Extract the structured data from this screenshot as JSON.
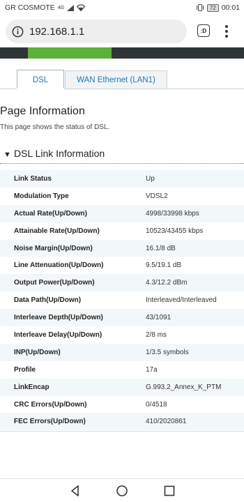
{
  "status_bar": {
    "carrier": "GR COSMOTE",
    "network_type": "4G",
    "battery": "72",
    "time": "00:01",
    "icons": [
      "signal-icon",
      "wifi-icon",
      "vibrate-icon",
      "battery-icon"
    ]
  },
  "browser": {
    "url": "192.168.1.1",
    "tab_count": ":D",
    "icons": [
      "info-icon",
      "tabs-icon",
      "more-vert-icon"
    ]
  },
  "colors": {
    "header_dark": "#2f3437",
    "header_green": "#5cb13a",
    "tab_text": "#1f79b5",
    "row_alt": "#f2f7fa"
  },
  "tabs": [
    {
      "label": "DSL",
      "active": true
    },
    {
      "label": "WAN Ethernet (LAN1)",
      "active": false
    }
  ],
  "page": {
    "title": "Page Information",
    "description": "This page shows the status of DSL."
  },
  "section": {
    "title": "DSL Link Information",
    "icon": "triangle-down-icon"
  },
  "rows": [
    {
      "label": "Link Status",
      "value": "Up"
    },
    {
      "label": "Modulation Type",
      "value": "VDSL2"
    },
    {
      "label": "Actual Rate(Up/Down)",
      "value": "4998/33998 kbps"
    },
    {
      "label": "Attainable Rate(Up/Down)",
      "value": "10523/43455 kbps"
    },
    {
      "label": "Noise Margin(Up/Down)",
      "value": "16.1/8 dB"
    },
    {
      "label": "Line Attenuation(Up/Down)",
      "value": "9.5/19.1 dB"
    },
    {
      "label": "Output Power(Up/Down)",
      "value": "4.3/12.2 dBm"
    },
    {
      "label": "Data Path(Up/Down)",
      "value": "Interleaved/Interleaved"
    },
    {
      "label": "Interleave Depth(Up/Down)",
      "value": "43/1091"
    },
    {
      "label": "Interleave Delay(Up/Down)",
      "value": "2/8 ms"
    },
    {
      "label": "INP(Up/Down)",
      "value": "1/3.5 symbols"
    },
    {
      "label": "Profile",
      "value": "17a"
    },
    {
      "label": "LinkEncap",
      "value": "G.993.2_Annex_K_PTM"
    },
    {
      "label": "CRC Errors(Up/Down)",
      "value": "0/4518"
    },
    {
      "label": "FEC Errors(Up/Down)",
      "value": "410/2020861"
    }
  ],
  "nav": {
    "icons": [
      "back-icon",
      "home-icon",
      "recents-icon"
    ]
  }
}
